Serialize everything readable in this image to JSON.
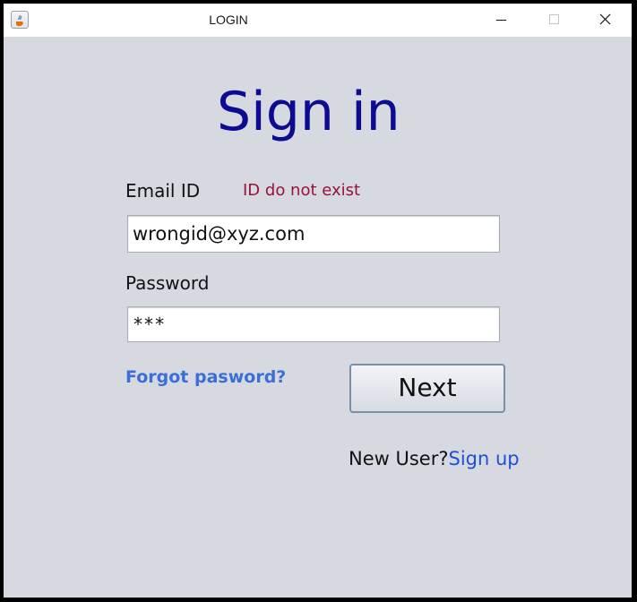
{
  "window": {
    "title": "LOGIN"
  },
  "icons": {
    "app": "java-app-icon",
    "minimize": "minimize-icon",
    "maximize": "maximize-icon",
    "close": "close-icon"
  },
  "form": {
    "heading": "Sign in",
    "email_label": "Email ID",
    "email_error": "ID do not exist",
    "email_value": "wrongid@xyz.com",
    "password_label": "Password",
    "password_value": "***",
    "forgot_link": "Forgot pasword?",
    "next_label": "Next",
    "new_user_prompt": "New User?",
    "signup_link": "Sign up"
  },
  "colors": {
    "background": "#d6d9e0",
    "heading": "#0c0b92",
    "error": "#98123a",
    "link": "#3c6ed8",
    "signup_link": "#1f4fd6"
  }
}
